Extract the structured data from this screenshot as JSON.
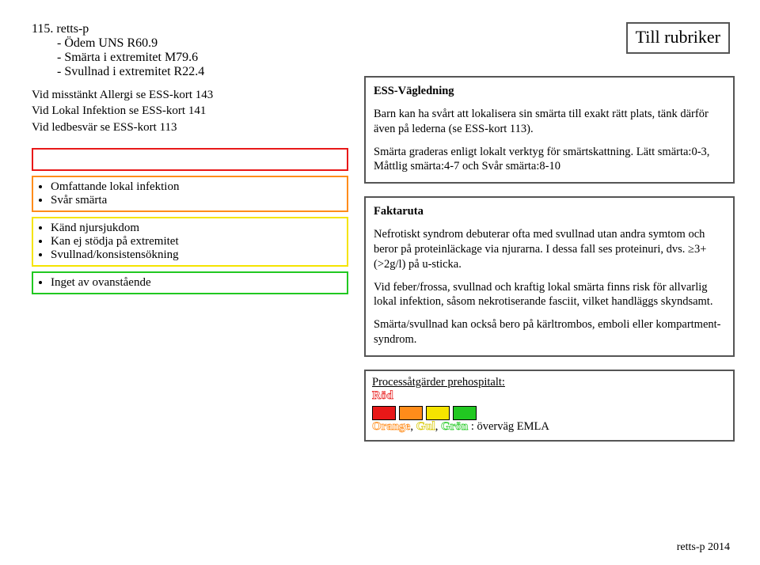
{
  "header_link": "Till rubriker",
  "title": {
    "line1": "115. retts-p",
    "line2": "- Ödem UNS R60.9",
    "line3": "- Smärta i extremitet M79.6",
    "line4": "- Svullnad i extremitet R22.4"
  },
  "references": {
    "r1": "Vid misstänkt Allergi se ESS-kort 143",
    "r2": "Vid Lokal Infektion se ESS-kort 141",
    "r3": "Vid ledbesvär se ESS-kort 113"
  },
  "boxes": {
    "red": [],
    "orange": [
      "Omfattande lokal infektion",
      "Svår smärta"
    ],
    "yellow": [
      "Känd njursjukdom",
      "Kan ej stödja på extremitet",
      "Svullnad/konsistensökning"
    ],
    "green": [
      "Inget av ovanstående"
    ]
  },
  "ess": {
    "title": "ESS-Vägledning",
    "p1": "Barn kan ha svårt att lokalisera sin smärta till exakt rätt plats, tänk därför även på lederna (se ESS-kort 113).",
    "p2": "Smärta graderas enligt lokalt verktyg för smärtskattning. Lätt smärta:0-3, Måttlig smärta:4-7 och Svår smärta:8-10"
  },
  "fakta": {
    "title": "Faktaruta",
    "p1": "Nefrotiskt syndrom debuterar ofta med svullnad utan andra symtom och beror på proteinläckage via njurarna. I dessa fall ses proteinuri, dvs. ≥3+(>2g/l) på u-sticka.",
    "p2": "Vid feber/frossa, svullnad och kraftig lokal smärta finns risk för allvarlig lokal infektion, såsom nekrotiserande fasciit, vilket handläggs skyndsamt.",
    "p3": "Smärta/svullnad kan också bero på kärltrombos, emboli eller kompartment-syndrom."
  },
  "process": {
    "title": "Processåtgärder prehospitalt:",
    "red_label": "Röd",
    "orange_label": "Orange",
    "yellow_label": "Gul",
    "green_label": "Grön",
    "rest": " : överväg EMLA"
  },
  "footer": "retts-p 2014"
}
